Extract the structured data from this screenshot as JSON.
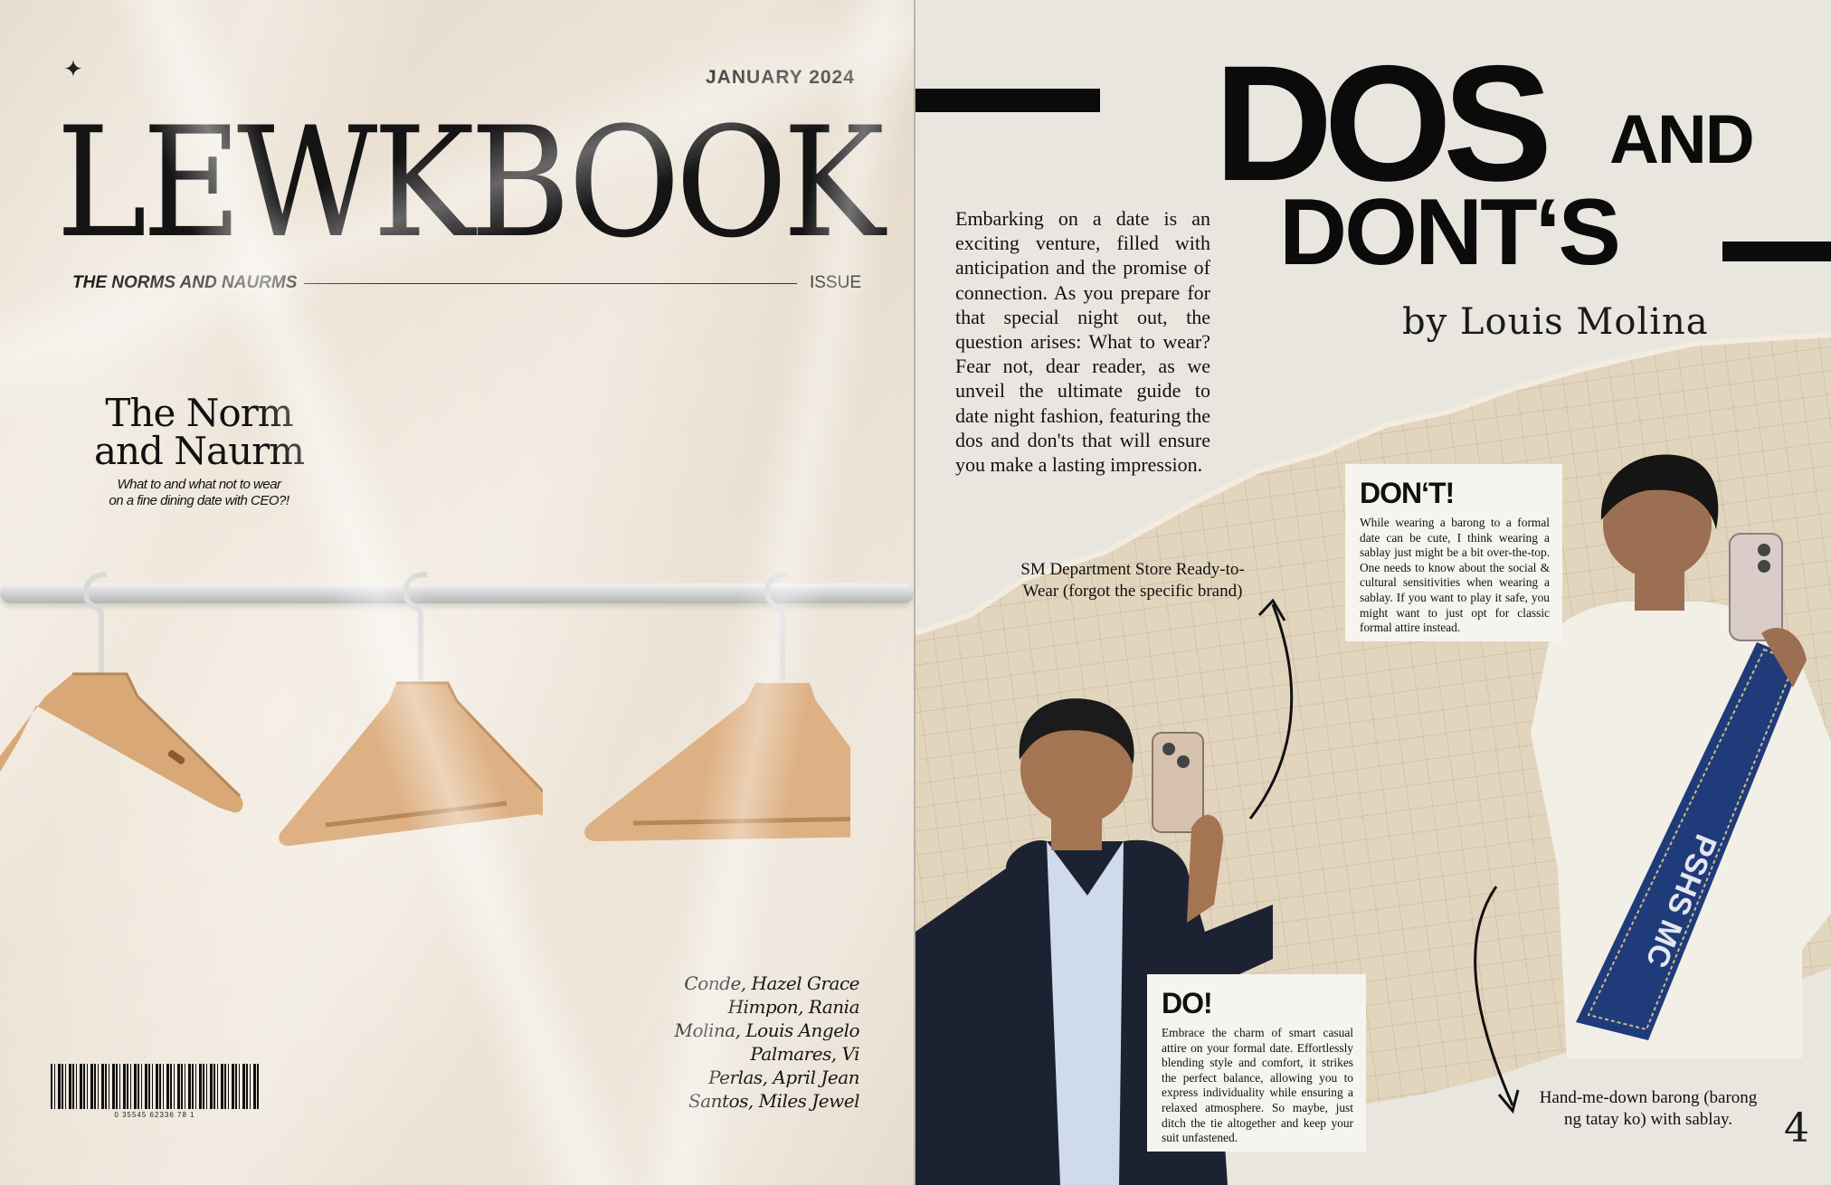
{
  "cover": {
    "issue_date": "JANUARY 2024",
    "masthead": "LEWKBOOK",
    "tagline": "THE NORMS AND NAURMS",
    "issue_label": "ISSUE",
    "feature_title_line1": "The Norm",
    "feature_title_line2": "and Naurm",
    "feature_subtitle_line1": "What to and what not to wear",
    "feature_subtitle_line2": "on a fine dining date with CEO?!",
    "contributors": [
      "Conde, Hazel Grace",
      "Himpon, Rania",
      "Molina, Louis Angelo",
      "Palmares, Vi",
      "Perlas, April Jean",
      "Santos, Miles Jewel"
    ],
    "barcode_number": "0 35545 62336 78 1"
  },
  "article": {
    "title_big": "DOS",
    "title_and": "AND",
    "title_second": "DONT‘S",
    "byline": "by Louis Molina",
    "intro": "Embarking on a date is an exciting venture, filled with anticipation and the promise of connection. As you prepare for that special night out, the question arises: What to wear? Fear not, dear reader, as we unveil the ultimate guide to date night fashion, featuring the dos and don'ts that will ensure you make a lasting impression.",
    "caption_outfit_1": "SM Department Store Ready-to-Wear (forgot the specific brand)",
    "caption_outfit_2": "Hand-me-down barong (barong ng tatay ko) with sablay.",
    "dont_heading": "DON‘T!",
    "dont_text": "While wearing a barong to a formal date can be cute, I think wearing a sablay just might be a bit over-the-top. One needs to know about the social & cultural sensitivities when wearing a sablay. If you want to play it safe, you might want to just opt for classic formal attire instead.",
    "do_heading": "DO!",
    "do_text": "Embrace the charm of smart casual attire on your formal date. Effortlessly blending style and comfort, it strikes the perfect balance, allowing you to express individuality while ensuring a relaxed atmosphere. So maybe, just ditch the tie altogether and keep your suit unfastened.",
    "page_number": "4",
    "sash_text": "PSHS MC"
  }
}
